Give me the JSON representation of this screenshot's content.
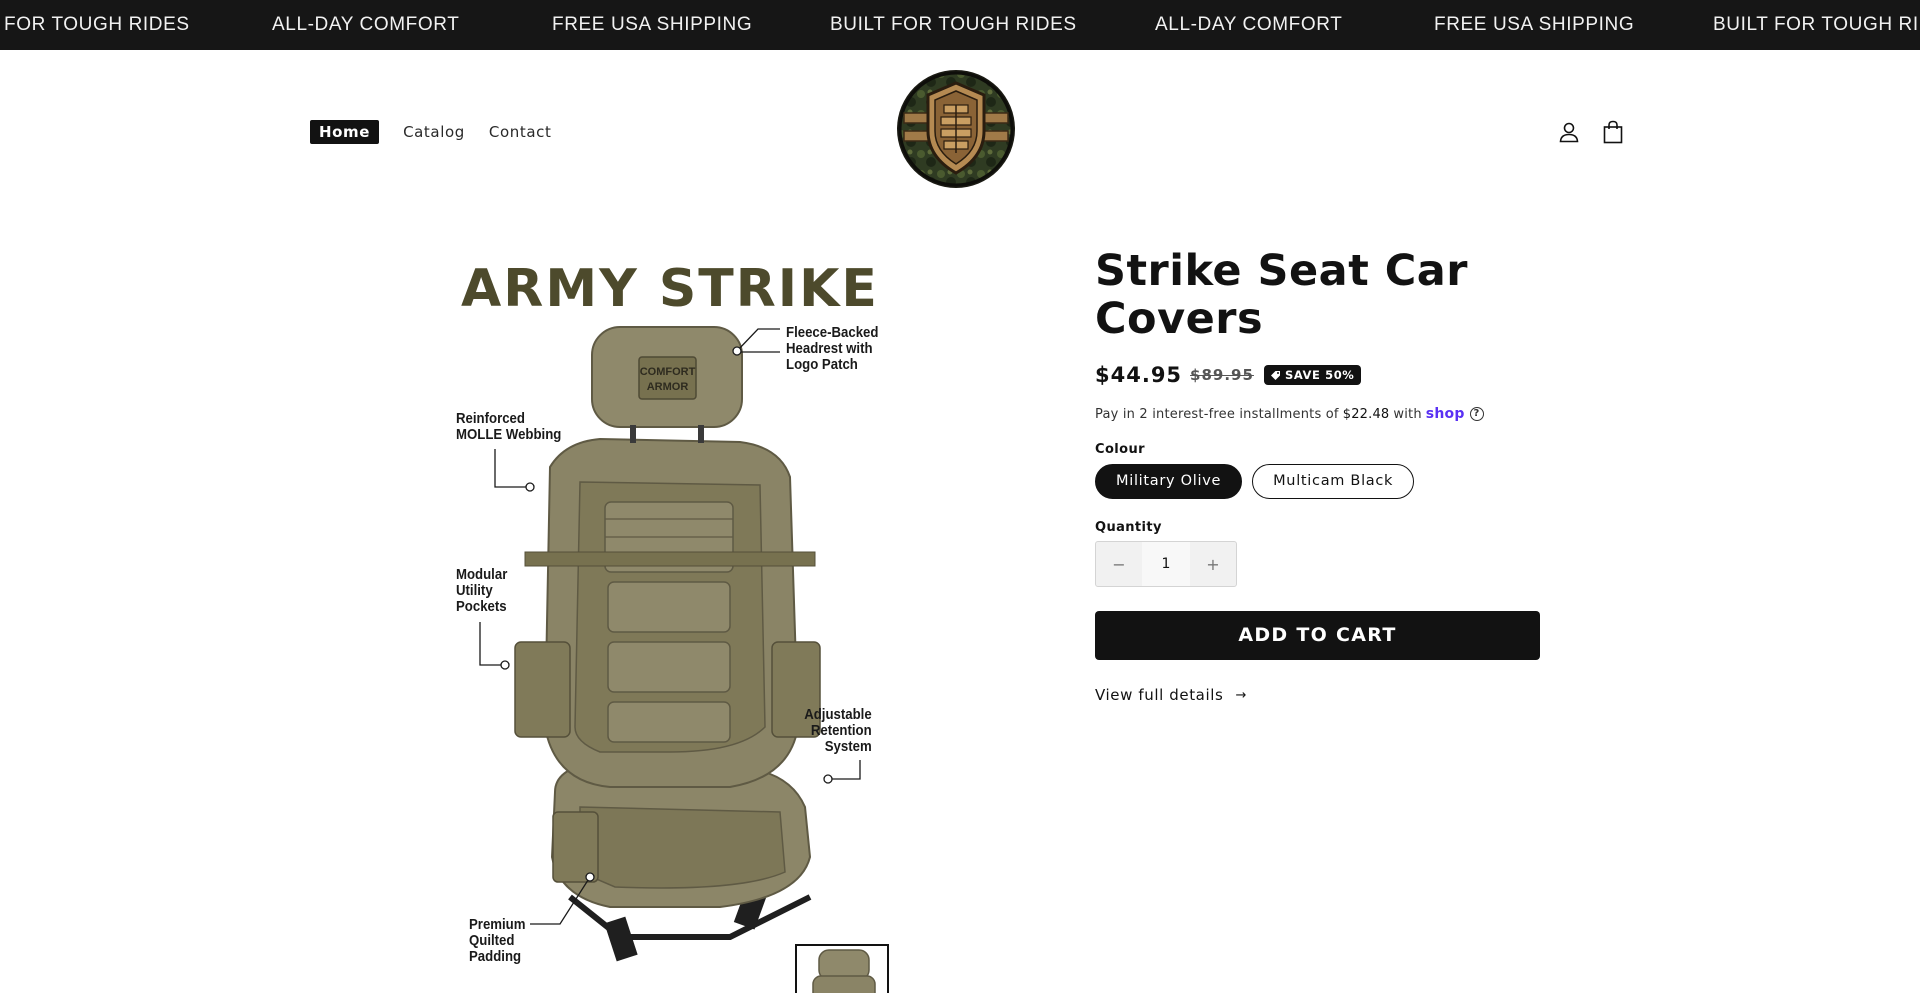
{
  "announcement": {
    "items": [
      "FOR TOUGH RIDES",
      "ALL-DAY COMFORT",
      "FREE USA SHIPPING",
      "BUILT FOR TOUGH RIDES",
      "ALL-DAY COMFORT",
      "FREE USA SHIPPING",
      "BUILT FOR TOUGH RIDES"
    ]
  },
  "nav": {
    "home": "Home",
    "catalog": "Catalog",
    "contact": "Contact"
  },
  "header": {
    "logo_icon": "shield-grid-logo",
    "account_icon": "user-icon",
    "cart_icon": "shopping-bag-icon"
  },
  "media": {
    "brand": "ARMY STRIKE",
    "patch": [
      "COMFORT",
      "ARMOR"
    ],
    "callouts": {
      "headrest": [
        "Fleece-Backed",
        "Headrest with",
        "Logo Patch"
      ],
      "molle": [
        "Reinforced",
        "MOLLE Webbing"
      ],
      "pockets": [
        "Modular",
        "Utility",
        "Pockets"
      ],
      "retention": [
        "Adjustable",
        "Retention",
        "System"
      ],
      "padding": [
        "Premium",
        "Quilted",
        "Padding"
      ]
    }
  },
  "product": {
    "title": "Strike Seat Car Covers",
    "price": "$44.95",
    "compare_price": "$89.95",
    "badge": "SAVE 50%",
    "installments_prefix": "Pay in 2 interest-free installments of",
    "installments_amount": "$22.48",
    "installments_with": "with",
    "installments_brand": "shop",
    "colour_label": "Colour",
    "colours": [
      "Military Olive",
      "Multicam Black"
    ],
    "selected_colour": "Military Olive",
    "quantity_label": "Quantity",
    "quantity": "1",
    "minus": "−",
    "plus": "+",
    "add_to_cart": "ADD TO CART",
    "view_details": "View full details",
    "details_arrow": "→"
  },
  "colors": {
    "accent": "#121212",
    "olive": "#7d7757",
    "shop_purple": "#5a31f4"
  }
}
